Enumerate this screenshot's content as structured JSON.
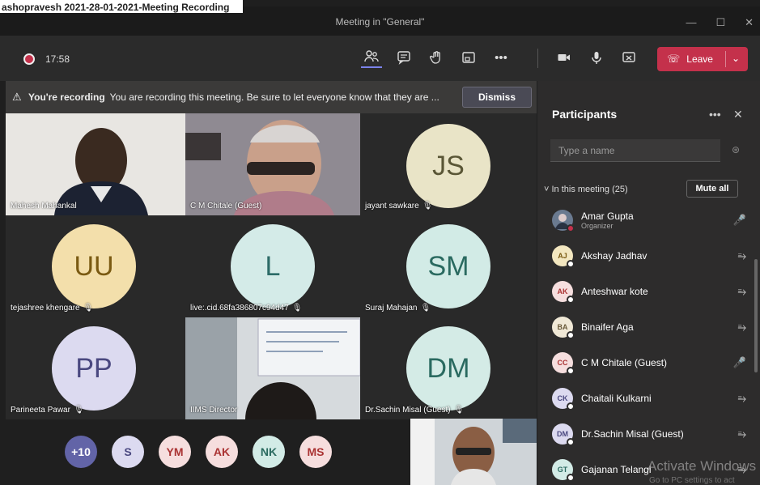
{
  "window": {
    "overlay_title": "ashopravesh 2021-28-01-2021-Meeting Recording",
    "title": "Meeting in \"General\""
  },
  "toolbar": {
    "timer": "17:58",
    "leave_label": "Leave"
  },
  "banner": {
    "heading": "You're recording",
    "message": "You are recording this meeting. Be sure to let everyone know that they are ...",
    "dismiss_label": "Dismiss"
  },
  "tiles": [
    {
      "name": "Mahesh Mahankal",
      "type": "video"
    },
    {
      "name": "C M Chitale (Guest)",
      "type": "video"
    },
    {
      "name": "jayant sawkare",
      "initials": "JS",
      "type": "avatar",
      "color": "#e9e4c7",
      "text_color": "#5a5636"
    },
    {
      "name": "tejashree khengare",
      "initials": "UU",
      "type": "avatar",
      "color": "#f3dfab",
      "text_color": "#7a5a12"
    },
    {
      "name": "live:.cid.68fa386807c94d47",
      "initials": "L",
      "type": "avatar",
      "color": "#d4ebe8",
      "text_color": "#2c6b67"
    },
    {
      "name": "Suraj Mahajan",
      "initials": "SM",
      "type": "avatar",
      "color": "#d2ebe6",
      "text_color": "#2a6a60"
    },
    {
      "name": "Parineeta Pawar",
      "initials": "PP",
      "type": "avatar",
      "color": "#dcdaf0",
      "text_color": "#4a4880"
    },
    {
      "name": "IIMS Director",
      "type": "video"
    },
    {
      "name": "Dr.Sachin Misal (Guest)",
      "initials": "DM",
      "type": "avatar",
      "color": "#d4ebe6",
      "text_color": "#2a6a60"
    }
  ],
  "bottom_avatars": [
    {
      "label": "+10",
      "color": "#6264a7",
      "text_color": "#ffffff"
    },
    {
      "label": "S",
      "color": "#dcdaf0",
      "text_color": "#4a4880"
    },
    {
      "label": "YM",
      "color": "#f6dede",
      "text_color": "#a33"
    },
    {
      "label": "AK",
      "color": "#f6dede",
      "text_color": "#a33"
    },
    {
      "label": "NK",
      "color": "#d2ebe6",
      "text_color": "#2a6a60"
    },
    {
      "label": "MS",
      "color": "#f6dede",
      "text_color": "#a33"
    }
  ],
  "panel": {
    "title": "Participants",
    "search_placeholder": "Type a name",
    "in_meeting_label": "In this meeting (25)",
    "mute_all_label": "Mute all",
    "participants": [
      {
        "initials": "",
        "name": "Amar Gupta",
        "role": "Organizer",
        "color": "#7a8aa0",
        "text_color": "#ffffff",
        "mic": "on"
      },
      {
        "initials": "AJ",
        "name": "Akshay Jadhav",
        "color": "#f3e7c0",
        "text_color": "#7a5a12",
        "mic": "muted"
      },
      {
        "initials": "AK",
        "name": "Anteshwar kote",
        "color": "#f6dede",
        "text_color": "#a33",
        "mic": "muted"
      },
      {
        "initials": "BA",
        "name": "Binaifer Aga",
        "color": "#f0e8d6",
        "text_color": "#6a5a3a",
        "mic": "muted"
      },
      {
        "initials": "CC",
        "name": "C M Chitale (Guest)",
        "color": "#f6dede",
        "text_color": "#a33",
        "mic": "on"
      },
      {
        "initials": "CK",
        "name": "Chaitali Kulkarni",
        "color": "#dcdaf0",
        "text_color": "#4a4880",
        "mic": "muted"
      },
      {
        "initials": "DM",
        "name": "Dr.Sachin Misal (Guest)",
        "color": "#dcdaf0",
        "text_color": "#4a4880",
        "mic": "muted"
      },
      {
        "initials": "GT",
        "name": "Gajanan Telangi",
        "color": "#d2ebe6",
        "text_color": "#2a6a60",
        "mic": "muted"
      }
    ]
  },
  "watermark": {
    "line1": "Activate Windows",
    "line2": "Go to PC settings to act"
  }
}
